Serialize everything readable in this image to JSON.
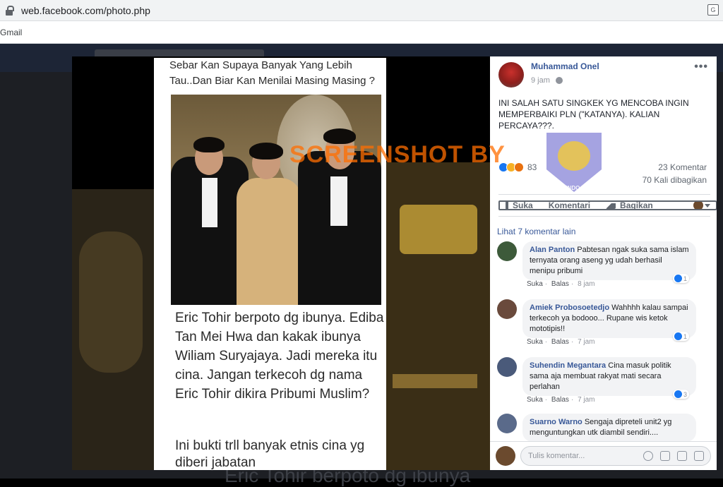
{
  "browser": {
    "url": "web.facebook.com/photo.php",
    "bookmark_gmail": "Gmail"
  },
  "photo": {
    "caption_top": "Sebar Kan Supaya Banyak Yang Lebih Tau..Dan Biar Kan Menilai Masing Masing ?",
    "caption_main": "Eric Tohir berpoto dg ibunya. Ediba Tan Mei Hwa dan kakak ibunya Wiliam Suryajaya. Jadi mereka itu cina. Jangan terkecoh dg nama Eric Tohir dikira Pribumi Muslim?",
    "caption_bottom": "Ini bukti trll banyak etnis cina yg diberi jabatan",
    "watermark": "SCREENSHOT BY",
    "background_text": "Eric Tohir berpoto dg ibunya"
  },
  "post": {
    "author": "Muhammad Onel",
    "time": "9 jam",
    "text": "INI SALAH SATU SINGKEK YG MENCOBA INGIN MEMPERBAIKI PLN (\"KATANYA). KALIAN PERCAYA???.",
    "stamp_label": "MAFINDO",
    "reaction_count": "83",
    "comments_count": "23 Komentar",
    "shares_count": "70 Kali dibagikan",
    "actions": {
      "like": "Suka",
      "comment": "Komentari",
      "share": "Bagikan"
    },
    "more_comments": "Lihat 7 komentar lain"
  },
  "comments": [
    {
      "name": "Alan Panton",
      "text": "Pabtesan ngak suka sama islam ternyata orang aseng yg udah berhasil menipu pribumi",
      "like": "Suka",
      "reply": "Balas",
      "time": "8 jam",
      "likes": "1"
    },
    {
      "name": "Amiek Probosoetedjo",
      "text": "Wahhhh kalau sampai terkecoh ya bodooo... Rupane wis ketok mototipis!!",
      "like": "Suka",
      "reply": "Balas",
      "time": "7 jam",
      "likes": "1"
    },
    {
      "name": "Suhendin Megantara",
      "text": "Cina masuk politik sama aja membuat rakyat mati secara perlahan",
      "like": "Suka",
      "reply": "Balas",
      "time": "7 jam",
      "likes": "3"
    },
    {
      "name": "Suarno Warno",
      "text": "Sengaja dipreteli unit2 yg menguntungkan utk diambil sendiri....",
      "like": "",
      "reply": "",
      "time": "",
      "likes": ""
    }
  ],
  "composer": {
    "placeholder": "Tulis komentar..."
  }
}
